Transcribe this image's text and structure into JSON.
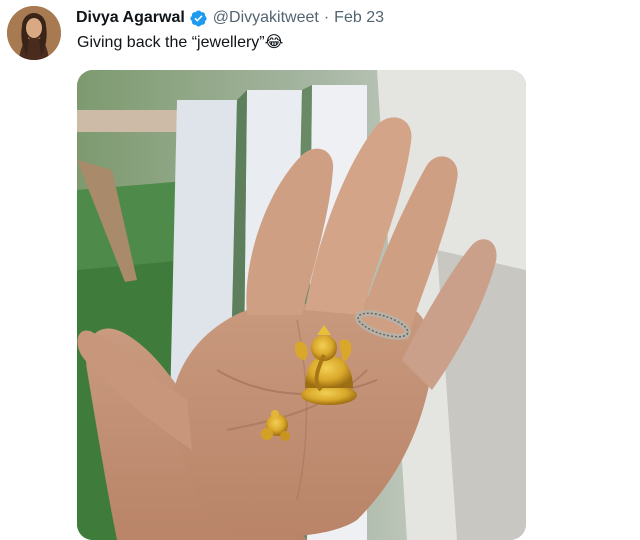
{
  "tweet": {
    "author_name": "Divya Agarwal",
    "handle": "@Divyakitweet",
    "separator": "·",
    "date": "Feb 23",
    "text": "Giving back the “jewellery”😂",
    "verified": true,
    "verified_color": "#1d9bf0"
  },
  "icons": {
    "verified": "verified-badge-icon",
    "avatar": "profile-photo"
  },
  "media": {
    "kind": "photo",
    "subject": "hand-holding-gold-ganesha-idol-and-small-ornament"
  }
}
